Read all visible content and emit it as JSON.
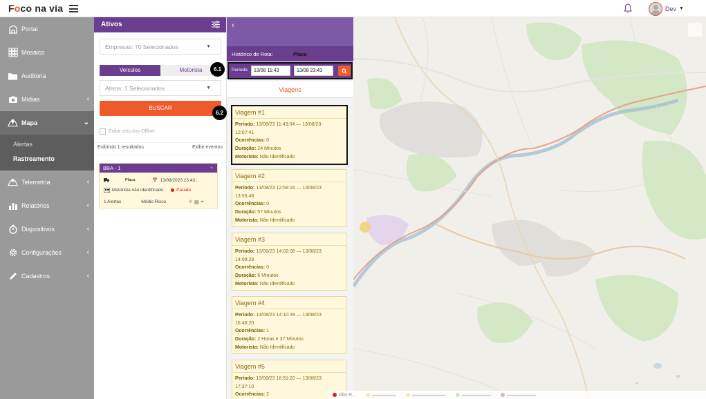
{
  "app": {
    "brand_prefix": "F",
    "brand_o": "o",
    "brand_suffix": "co na via"
  },
  "user": {
    "name": "Dev"
  },
  "nav": {
    "items": [
      {
        "label": "Portal",
        "icon": "building-icon",
        "chevron": false
      },
      {
        "label": "Mosaico",
        "icon": "grid-icon",
        "chevron": false
      },
      {
        "label": "Auditoria",
        "icon": "folder-icon",
        "chevron": false
      },
      {
        "label": "Mídias",
        "icon": "camera-icon",
        "chevron": true
      },
      {
        "label": "Mapa",
        "icon": "map-icon",
        "chevron": true,
        "active": true
      },
      {
        "label": "Telemetria",
        "icon": "telemetry-icon",
        "chevron": true
      },
      {
        "label": "Relatórios",
        "icon": "chart-icon",
        "chevron": true
      },
      {
        "label": "Dispositivos",
        "icon": "timer-icon",
        "chevron": true
      },
      {
        "label": "Configurações",
        "icon": "cog-icon",
        "chevron": true
      },
      {
        "label": "Cadastros",
        "icon": "pencil-icon",
        "chevron": true
      }
    ],
    "mapa_sub": [
      "Alertas",
      "Rastreamento"
    ]
  },
  "ativos": {
    "title": "Ativos",
    "empresas": "Empresas: 70 Selecionados",
    "tab_veiculos": "Veículos",
    "tab_motorista": "Motorista",
    "ativos_select": "Ativos: 1 Selecionados",
    "buscar": "BUSCAR",
    "offline": "Exibir veículos Offline",
    "results": "Exibindo 1 resultados",
    "ver_eventos": "Exibir eventos",
    "card": {
      "title": "BBA - 1",
      "placa": "Placa",
      "datetime": "13/08/2023 23:43:..",
      "driver": "Motorista não identificado",
      "status": "Parado",
      "alerts": "1 Alertas",
      "risk": "Médio Risco"
    }
  },
  "route": {
    "hist_label": "Histórico de Rota:",
    "placa": "Placa",
    "periodo_label": "Período:",
    "from": "13/08 11:43",
    "to": "13/08 23:43",
    "tab": "Viagens",
    "labels": {
      "periodo": "Período:",
      "ocorrencias": "Ocorrências:",
      "duracao": "Duração:",
      "motorista": "Motorista:"
    },
    "trips": [
      {
        "title": "Viagem #1",
        "periodo_1": "13/08/23 11:43:04 — 13/08/23",
        "periodo_2": "12:07:41",
        "ocorrencias": "0",
        "duracao": "24 Minutos",
        "motorista": "Não Identificado"
      },
      {
        "title": "Viagem #2",
        "periodo_1": "13/08/23 12:58:16 — 13/08/23",
        "periodo_2": "13:55:48",
        "ocorrencias": "0",
        "duracao": "57 Minutos",
        "motorista": "Não Identificado"
      },
      {
        "title": "Viagem #3",
        "periodo_1": "13/08/23 14:02:08 — 13/08/23",
        "periodo_2": "14:08:29",
        "ocorrencias": "0",
        "duracao": "6 Minutos",
        "motorista": "Não Identificado"
      },
      {
        "title": "Viagem #4",
        "periodo_1": "13/08/23 14:10:39 — 13/08/23",
        "periodo_2": "16:48:20",
        "ocorrencias": "1",
        "duracao": "2 Horas e 37 Minutos",
        "motorista": "Não Identificado"
      },
      {
        "title": "Viagem #5",
        "periodo_1": "13/08/23 16:51:20 — 13/08/23",
        "periodo_2": "17:37:10",
        "ocorrencias": "2",
        "duracao": "",
        "motorista": ""
      }
    ]
  },
  "badges": {
    "b1": "6.1",
    "b2": "6.2"
  },
  "map": {
    "legend_first": "Alto R..."
  },
  "colors": {
    "purple": "#6a3d8e",
    "orange": "#ee5a2b",
    "nav": "#9a9a9a"
  }
}
